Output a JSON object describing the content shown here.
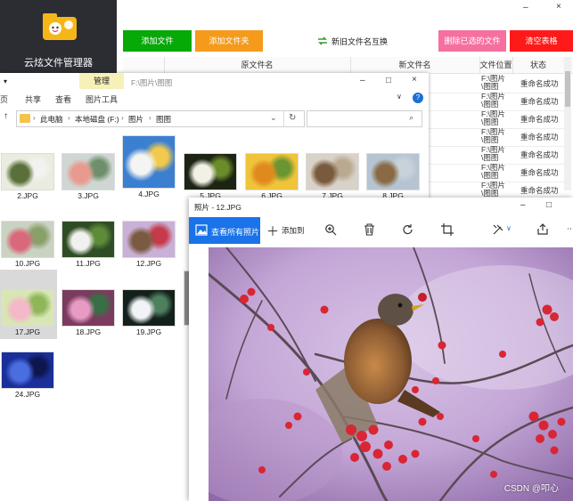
{
  "app": {
    "title": "云炫文件管理器",
    "buttons": {
      "add_file": "添加文件",
      "add_folder": "添加文件夹",
      "swap_names": "新旧文件名互换",
      "delete_selected": "删除已选的文件",
      "clear_table": "清空表格"
    },
    "window": {
      "minimize": "–",
      "close": "×"
    },
    "table": {
      "headers": [
        "原文件名",
        "新文件名",
        "文件位置",
        "状态"
      ],
      "rows": [
        {
          "location": "F:\\图片\\图图",
          "status": "重命名成功"
        },
        {
          "location": "F:\\图片\\图图",
          "status": "重命名成功"
        },
        {
          "location": "F:\\图片\\图图",
          "status": "重命名成功"
        },
        {
          "location": "F:\\图片\\图图",
          "status": "重命名成功"
        },
        {
          "location": "F:\\图片\\图图",
          "status": "重命名成功"
        },
        {
          "location": "F:\\图片\\图图",
          "status": "重命名成功"
        },
        {
          "location": "F:\\图片\\图图",
          "status": "重命名成功"
        }
      ],
      "colors": {
        "green": "#07a907",
        "orange": "#f59a1b",
        "pink": "#f570a0",
        "red": "#ff1a1a"
      }
    }
  },
  "explorer": {
    "title_path": "F:\\图片\\图图",
    "manage_tab": "管理",
    "ribbon": {
      "home": "页",
      "share": "共享",
      "view": "查看",
      "picture_tools": "图片工具"
    },
    "window": {
      "minimize": "–",
      "maximize": "□",
      "close": "×"
    },
    "breadcrumb": [
      "此电脑",
      "本地磁盘 (F:)",
      "图片",
      "图图"
    ],
    "files": [
      {
        "name": "2.JPG",
        "colors": [
          "#e9ece0",
          "#5a6f3a",
          "#f2f2ee"
        ]
      },
      {
        "name": "3.JPG",
        "colors": [
          "#cfd6d3",
          "#e99a8f",
          "#6d8f6b"
        ]
      },
      {
        "name": "4.JPG",
        "colors": [
          "#3b7fd1",
          "#f4f4f2",
          "#f0c94d"
        ]
      },
      {
        "name": "5.JPG",
        "colors": [
          "#1d2414",
          "#f2f1e6",
          "#6b8c2a"
        ]
      },
      {
        "name": "6.JPG",
        "colors": [
          "#f0c43a",
          "#e08a1e",
          "#6b9530"
        ]
      },
      {
        "name": "7.JPG",
        "colors": [
          "#d9d2c8",
          "#7a5a3c",
          "#b8a990"
        ]
      },
      {
        "name": "8.JPG",
        "colors": [
          "#b6c4d2",
          "#8a6a44",
          "#c9d1da"
        ]
      },
      {
        "name": "10.JPG",
        "colors": [
          "#c9d3c1",
          "#d9687a",
          "#8aa06b"
        ]
      },
      {
        "name": "11.JPG",
        "colors": [
          "#2e4d24",
          "#f1f1ee",
          "#5e8b3a"
        ]
      },
      {
        "name": "12.JPG",
        "colors": [
          "#c9b0d6",
          "#7a5a40",
          "#c63a4a"
        ]
      },
      {
        "name": "17.JPG",
        "colors": [
          "#d8e6b5",
          "#f3b9c8",
          "#8fb75a"
        ]
      },
      {
        "name": "18.JPG",
        "colors": [
          "#7a3b5e",
          "#e89ac4",
          "#3a6e45"
        ]
      },
      {
        "name": "19.JPG",
        "colors": [
          "#14201a",
          "#f1f3f7",
          "#4e7f5e"
        ]
      },
      {
        "name": "24.JPG",
        "colors": [
          "#1b2f9a",
          "#4a6ee0",
          "#0e1650"
        ]
      }
    ]
  },
  "viewer": {
    "title": "照片 - 12.JPG",
    "view_all": "查看所有照片",
    "add_to": "添加到",
    "window": {
      "minimize": "–",
      "maximize": "□"
    },
    "accent": "#1a73e8"
  },
  "watermark": "CSDN @叩心"
}
